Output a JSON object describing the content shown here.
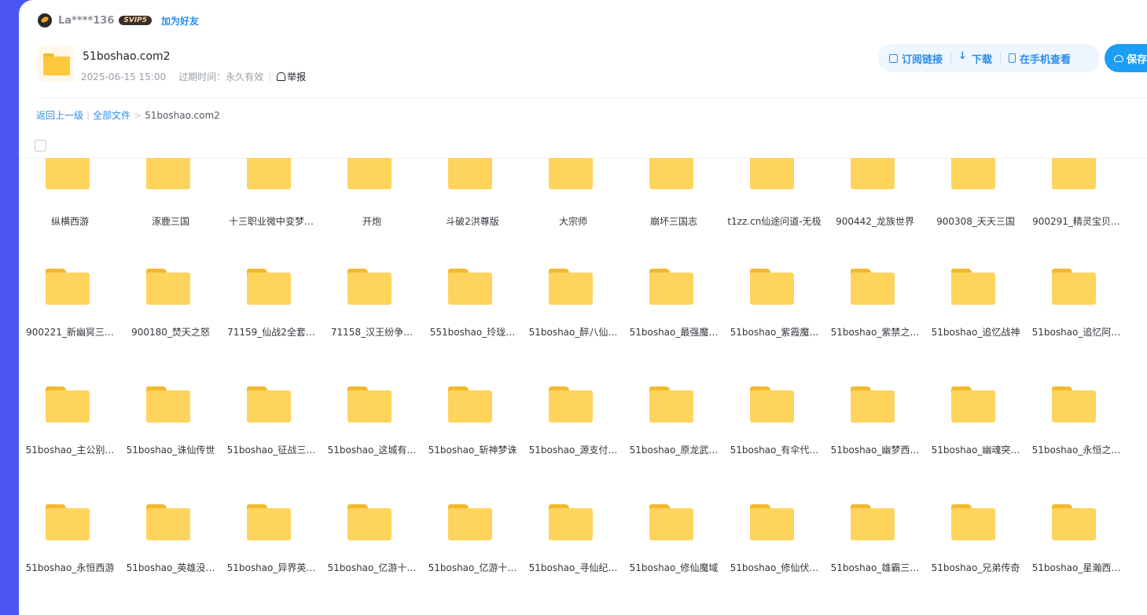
{
  "user": {
    "name": "La****136",
    "vip_badge": "SVIP5",
    "add_friend": "加为好友"
  },
  "share": {
    "title": "51boshao.com2",
    "date": "2025-06-15 15:00",
    "expire": "过期时间：永久有效",
    "report": "举报"
  },
  "actions": {
    "subscribe": "订阅链接",
    "download": "下载",
    "mobile": "在手机查看",
    "save": "保存"
  },
  "breadcrumb": {
    "back": "返回上一级",
    "all": "全部文件",
    "arrow": ">",
    "current": "51boshao.com2"
  },
  "files": [
    "纵横西游",
    "涿鹿三国",
    "十三职业微中变梦…",
    "开炮",
    "斗破2洪尊版",
    "大宗师",
    "崩坏三国志",
    "t1zz.cn仙途问道-无极",
    "900442_龙族世界",
    "900308_天天三国",
    "900291_精灵宝贝…",
    "900221_新幽冥三…",
    "900180_焚天之怒",
    "71159_仙战2全套…",
    "71158_汉王纷争…",
    "551boshao_玲珑…",
    "51boshao_醉八仙…",
    "51boshao_最强魔…",
    "51boshao_紫霞魔…",
    "51boshao_紫禁之…",
    "51boshao_追忆战神",
    "51boshao_追忆阿…",
    "51boshao_主公别…",
    "51boshao_诛仙传世",
    "51boshao_征战三…",
    "51boshao_这城有…",
    "51boshao_斩神梦诛",
    "51boshao_源支付…",
    "51boshao_原龙武…",
    "51boshao_有伞代…",
    "51boshao_幽梦西…",
    "51boshao_幽魂突…",
    "51boshao_永恒之…",
    "51boshao_永恒西游",
    "51boshao_英雄没…",
    "51boshao_异界英…",
    "51boshao_亿游十…",
    "51boshao_亿游十…",
    "51boshao_寻仙纪…",
    "51boshao_修仙魔域",
    "51boshao_修仙伏…",
    "51boshao_雄霸三…",
    "51boshao_兄弟传奇",
    "51boshao_星瀚西…"
  ]
}
